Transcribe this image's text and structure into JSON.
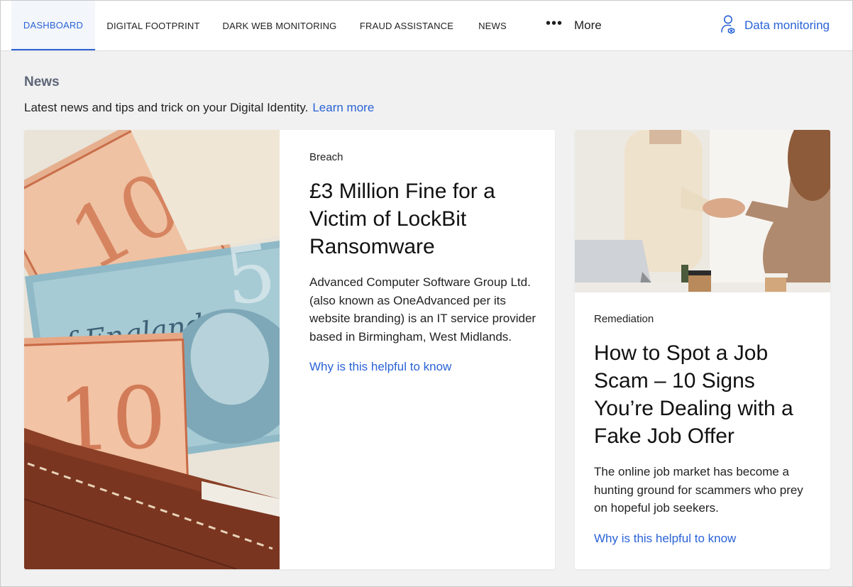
{
  "nav": {
    "tabs": [
      {
        "label": "DASHBOARD",
        "active": true
      },
      {
        "label": "DIGITAL FOOTPRINT",
        "active": false
      },
      {
        "label": "DARK WEB MONITORING",
        "active": false
      },
      {
        "label": "FRAUD ASSISTANCE",
        "active": false
      },
      {
        "label": "NEWS",
        "active": false
      }
    ],
    "more_icon": "ellipsis-icon",
    "more_label": "More",
    "monitor_icon": "user-shield-icon",
    "monitor_label": "Data monitoring"
  },
  "section": {
    "title": "News",
    "subtitle": "Latest news and tips and trick on your Digital Identity.",
    "learn_more": "Learn more"
  },
  "articles": [
    {
      "image": "banknotes-in-wallet-photo",
      "category": "Breach",
      "title": "£3 Million Fine for a Victim of LockBit Ransomware",
      "description": "Advanced Computer Software Group Ltd. (also known as OneAdvanced per its website branding) is an IT service provider based in Birmingham, West Midlands.",
      "link": "Why is this helpful to know"
    },
    {
      "image": "handshake-photo",
      "category": "Remediation",
      "title": "How to Spot a Job Scam – 10 Signs You’re Dealing with a Fake Job Offer",
      "description": "The online job market has become a hunting ground for scammers who prey on hopeful job seekers.",
      "link": "Why is this helpful to know"
    }
  ],
  "colors": {
    "accent": "#2a63d6",
    "heading_gray": "#5d6577",
    "page_bg": "#f1f1f1"
  }
}
